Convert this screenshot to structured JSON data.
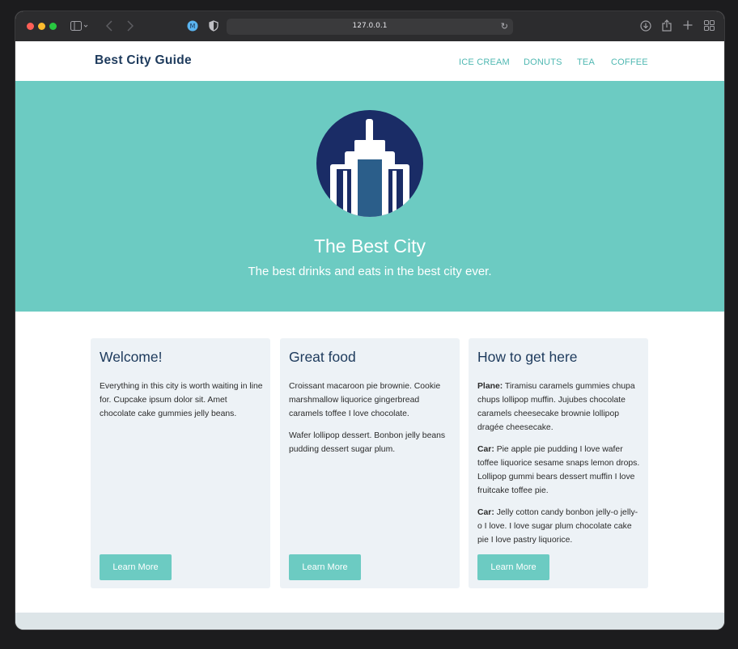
{
  "browser": {
    "url": "127.0.0.1"
  },
  "navbar": {
    "brand": "Best City Guide",
    "links": [
      "ICE CREAM",
      "DONUTS",
      "TEA",
      "COFFEE"
    ]
  },
  "hero": {
    "title": "The Best City",
    "subtitle": "The best drinks and eats in the best city ever."
  },
  "cards": [
    {
      "title": "Welcome!",
      "paragraphs": [
        {
          "lead": "",
          "text": "Everything in this city is worth waiting in line for. Cupcake ipsum dolor sit. Amet chocolate cake gummies jelly beans."
        }
      ],
      "button": "Learn More"
    },
    {
      "title": "Great food",
      "paragraphs": [
        {
          "lead": "",
          "text": "Croissant macaroon pie brownie. Cookie marshmallow liquorice gingerbread caramels toffee I love chocolate."
        },
        {
          "lead": "",
          "text": "Wafer lollipop dessert. Bonbon jelly beans pudding dessert sugar plum."
        }
      ],
      "button": "Learn More"
    },
    {
      "title": "How to get here",
      "paragraphs": [
        {
          "lead": "Plane:",
          "text": "Tiramisu caramels gummies chupa chups lollipop muffin. Jujubes chocolate caramels cheesecake brownie lollipop dragée cheesecake."
        },
        {
          "lead": "Car:",
          "text": "Pie apple pie pudding I love wafer toffee liquorice sesame snaps lemon drops. Lollipop gummi bears dessert muffin I love fruitcake toffee pie."
        },
        {
          "lead": "Car:",
          "text": "Jelly cotton candy bonbon jelly-o jelly-o I love. I love sugar plum chocolate cake pie I love pastry liquorice."
        }
      ],
      "button": "Learn More"
    }
  ],
  "colors": {
    "brand_navy": "#1d3a5c",
    "teal": "#6ccbc2",
    "card_bg": "#edf2f6"
  },
  "icons": [
    "sidebar-toggle-icon",
    "back-icon",
    "forward-icon",
    "shield-icon",
    "reload-icon",
    "download-icon",
    "share-icon",
    "new-tab-icon",
    "tab-overview-icon",
    "skyscraper-logo-icon"
  ]
}
